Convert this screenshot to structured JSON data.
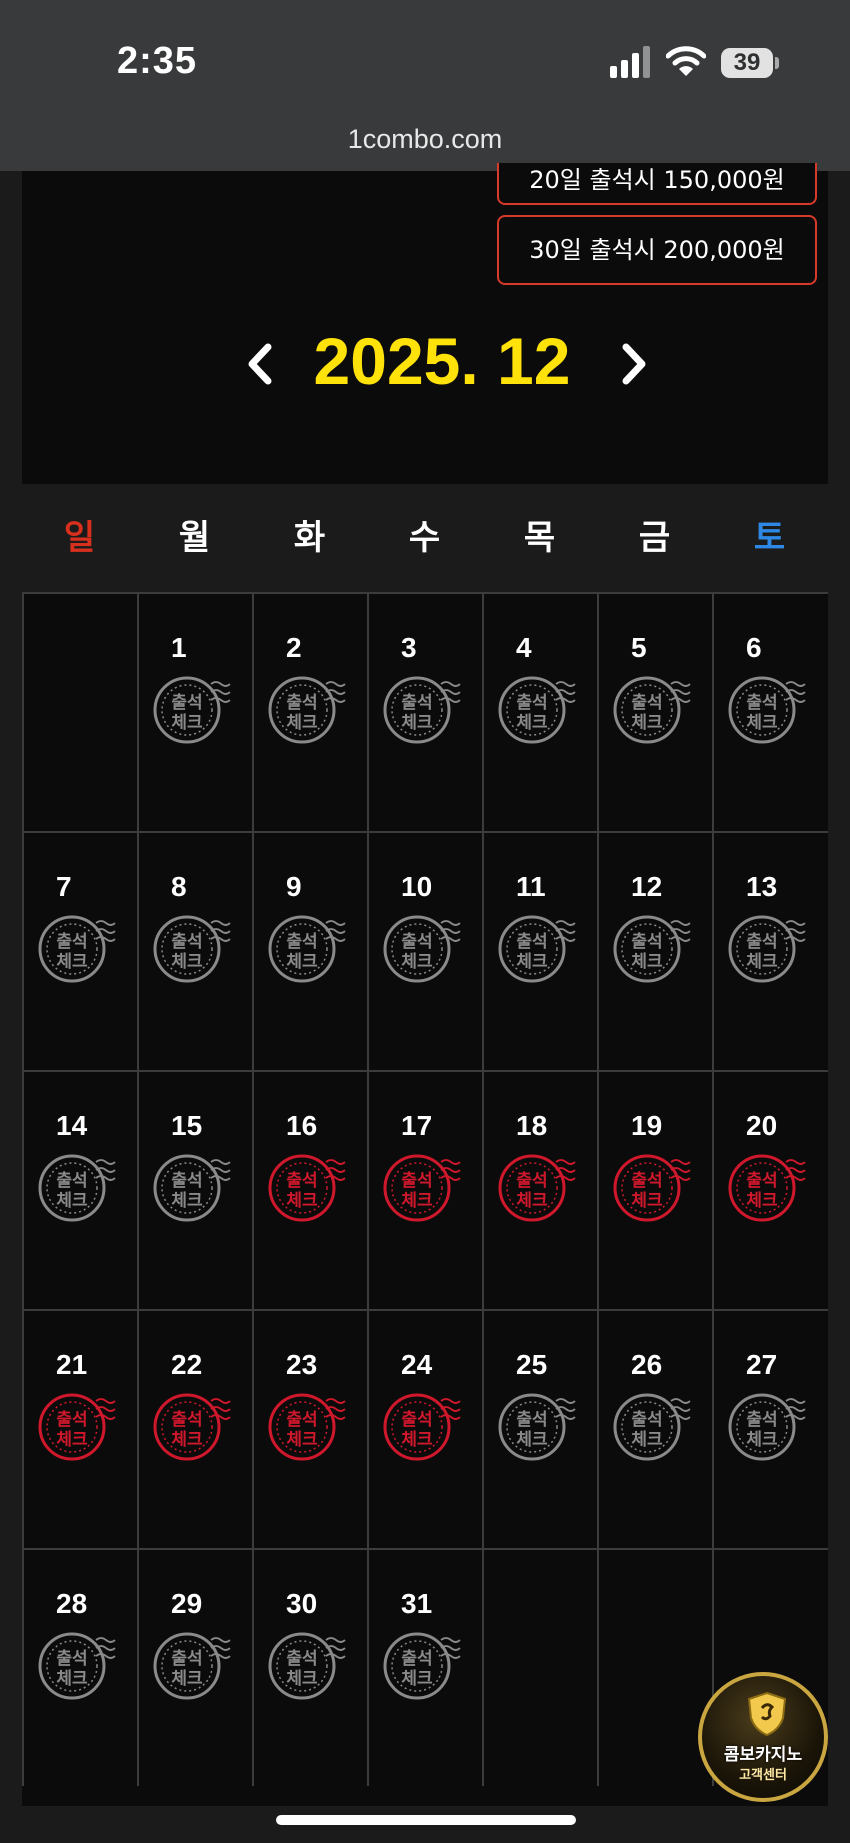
{
  "status_bar": {
    "time": "2:35",
    "battery": "39",
    "icons": [
      "signal-icon",
      "wifi-icon",
      "battery-icon"
    ]
  },
  "browser": {
    "url": "1combo.com"
  },
  "rewards": [
    {
      "label": "20일 출석시 150,000원"
    },
    {
      "label": "30일 출석시 200,000원"
    }
  ],
  "calendar": {
    "month_label": "2025. 12",
    "prev_icon": "chevron-left-icon",
    "next_icon": "chevron-right-icon",
    "weekdays": [
      "일",
      "월",
      "화",
      "수",
      "목",
      "금",
      "토"
    ],
    "weekday_colors": {
      "sunday": "#d9301e",
      "saturday": "#2e89e6",
      "default": "#ffffff"
    },
    "stamp_text": [
      "출석",
      "체크"
    ],
    "start_offset": 1,
    "days_in_month": 31,
    "checked_days": [
      16,
      17,
      18,
      19,
      20,
      21,
      22,
      23,
      24
    ],
    "stamp_colors": {
      "checked": "#d0182c",
      "unchecked": "#8a8a8a"
    },
    "accent_color": "#ffe20a"
  },
  "support_badge": {
    "line1": "콤보카지노",
    "line2": "고객센터"
  }
}
